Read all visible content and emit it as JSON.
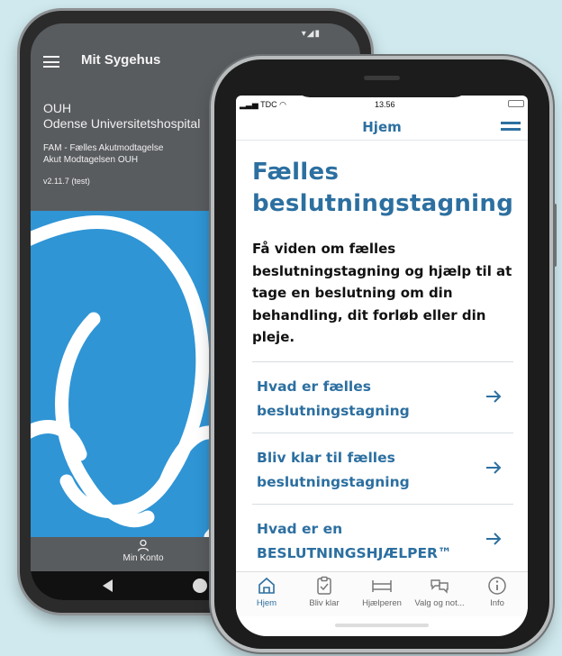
{
  "android": {
    "status_icons": "▾◢▮",
    "app_title": "Mit Sygehus",
    "org_short": "OUH",
    "org_full": "Odense Universitetshospital",
    "dept_line1": "FAM - Fælles Akutmodtagelse",
    "dept_line2": "Akut Modtagelsen OUH",
    "version": "v2.11.7 (test)",
    "hero_color": "#2f95d5",
    "nav_label": "Min Konto",
    "nav_icon": "person-icon"
  },
  "iphone": {
    "status": {
      "carrier": "TDC",
      "time": "13.56"
    },
    "header_title": "Hjem",
    "heading_line1": "Fælles",
    "heading_line2": "beslutningstagning",
    "lead_text": "Få viden om fælles beslutningstagning og hjælp til at tage en beslutning om din behandling, dit forløb eller din pleje.",
    "links": [
      {
        "line1": "Hvad er fælles",
        "line2": "beslutningstagning"
      },
      {
        "line1": "Bliv klar til fælles",
        "line2": "beslutningstagning"
      },
      {
        "line1": "Hvad er en",
        "line2": "BESLUTNINGSHJÆLPER™"
      }
    ],
    "tabs": [
      {
        "label": "Hjem",
        "icon": "home-icon",
        "active": true
      },
      {
        "label": "Bliv klar",
        "icon": "clipboard-icon"
      },
      {
        "label": "Hjælperen",
        "icon": "bed-icon"
      },
      {
        "label": "Valg og not...",
        "icon": "chat-icon"
      },
      {
        "label": "Info",
        "icon": "info-icon"
      }
    ],
    "accent_color": "#2c6fa0"
  }
}
